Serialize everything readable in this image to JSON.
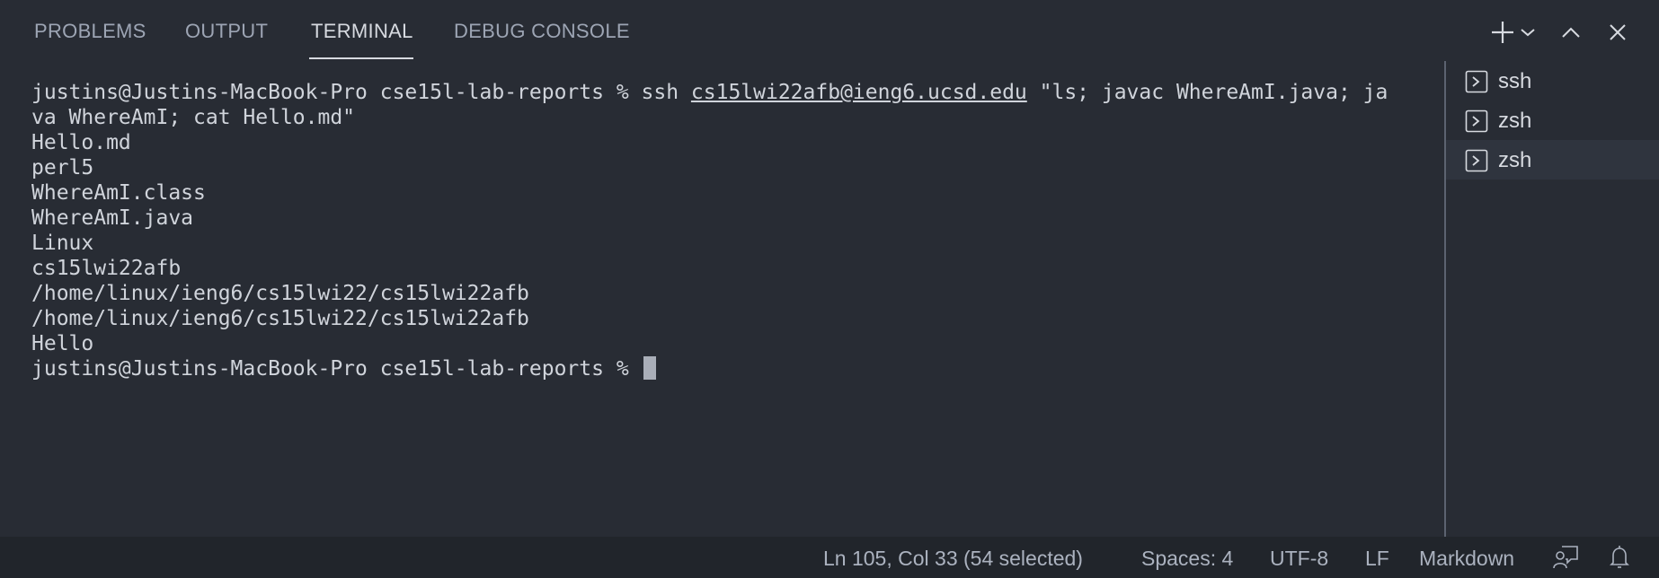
{
  "panel": {
    "tabs": [
      {
        "label": "PROBLEMS",
        "active": false
      },
      {
        "label": "OUTPUT",
        "active": false
      },
      {
        "label": "TERMINAL",
        "active": true
      },
      {
        "label": "DEBUG CONSOLE",
        "active": false
      }
    ],
    "actions": [
      "plus-icon",
      "chevron-down-icon",
      "chevron-up-icon",
      "close-icon"
    ]
  },
  "terminal": {
    "command_line": {
      "prompt": "justins@Justins-MacBook-Pro cse15l-lab-reports % ",
      "command": "ssh ",
      "link": "cs15lwi22afb@ieng6.ucsd.edu",
      "args_line1": " \"ls; javac WhereAmI.java; ja",
      "args_line2": "va WhereAmI; cat Hello.md\""
    },
    "output_lines": [
      "Hello.md",
      "perl5",
      "WhereAmI.class",
      "WhereAmI.java",
      "Linux",
      "cs15lwi22afb",
      "/home/linux/ieng6/cs15lwi22/cs15lwi22afb",
      "/home/linux/ieng6/cs15lwi22/cs15lwi22afb",
      "Hello"
    ],
    "final_prompt": "justins@Justins-MacBook-Pro cse15l-lab-reports % "
  },
  "shells": [
    {
      "label": "ssh",
      "icon": "terminal-icon",
      "active": false
    },
    {
      "label": "zsh",
      "icon": "terminal-icon",
      "active": false
    },
    {
      "label": "zsh",
      "icon": "terminal-icon",
      "active": true
    }
  ],
  "statusbar": {
    "position": "Ln 105, Col 33 (54 selected)",
    "indent": "Spaces: 4",
    "encoding": "UTF-8",
    "eol": "LF",
    "language": "Markdown",
    "icons": [
      "feedback-icon",
      "bell-icon"
    ]
  },
  "colors": {
    "background": "#282c34",
    "statusbar": "#21252b",
    "text": "#d0d4db"
  }
}
